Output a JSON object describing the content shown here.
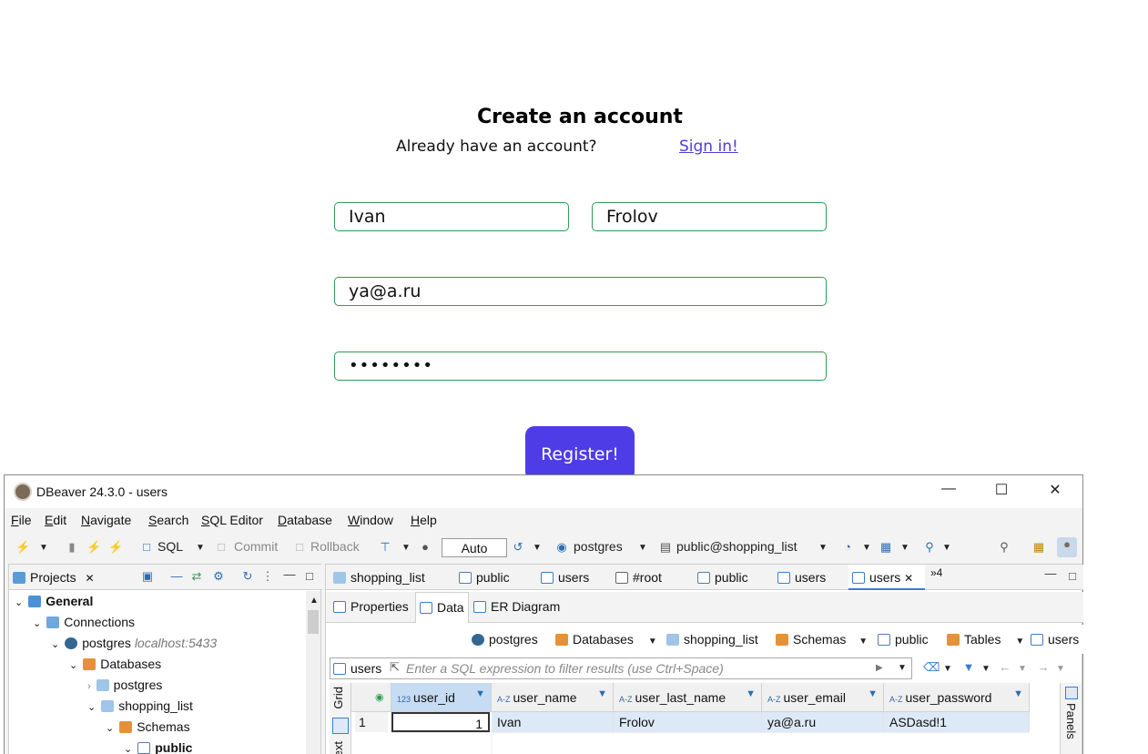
{
  "form": {
    "title": "Create an account",
    "already_text": "Already have an account?",
    "signin_link": "Sign in!",
    "first_name_value": "Ivan",
    "last_name_value": "Frolov",
    "email_value": "ya@a.ru",
    "password_value": "••••••••",
    "register_label": "Register!",
    "accent": "#4e3ce6",
    "border_color": "#2e9b53"
  },
  "dbeaver": {
    "window_title": "DBeaver 24.3.0 - users",
    "menu": [
      {
        "ul": "F",
        "rest": "ile"
      },
      {
        "ul": "E",
        "rest": "dit"
      },
      {
        "ul": "N",
        "rest": "avigate"
      },
      {
        "ul": "S",
        "rest": "earch"
      },
      {
        "ul": "S",
        "rest": "QL Editor"
      },
      {
        "ul": "D",
        "rest": "atabase"
      },
      {
        "ul": "W",
        "rest": "indow"
      },
      {
        "ul": "H",
        "rest": "elp"
      }
    ],
    "toolbar": {
      "sql": "SQL",
      "commit": "Commit",
      "rollback": "Rollback",
      "auto": "Auto",
      "connection": "postgres",
      "schema": "public@shopping_list"
    },
    "projects": {
      "tab": "Projects",
      "tree": [
        {
          "label": "General",
          "bold": true
        },
        {
          "label": "Connections"
        },
        {
          "label": "postgres",
          "extra": "localhost:5433"
        },
        {
          "label": "Databases"
        },
        {
          "label": "postgres"
        },
        {
          "label": "shopping_list"
        },
        {
          "label": "Schemas"
        },
        {
          "label": "public",
          "bold": true
        }
      ]
    },
    "editor_tabs": [
      "shopping_list",
      "public",
      "users",
      "#root",
      "public",
      "users",
      "users"
    ],
    "tabs_overflow": "»4",
    "sub_tabs": [
      "Properties",
      "Data",
      "ER Diagram"
    ],
    "breadcrumbs": [
      "postgres",
      "Databases",
      "shopping_list",
      "Schemas",
      "public",
      "Tables",
      "users"
    ],
    "filter": {
      "table_label": "users",
      "placeholder": "Enter a SQL expression to filter results (use Ctrl+Space)"
    },
    "grid": {
      "vtab": "Grid",
      "vtab2": "Text",
      "columns": [
        "user_id",
        "user_name",
        "user_last_name",
        "user_email",
        "user_password"
      ],
      "rows": [
        {
          "n": "1",
          "cells": [
            "1",
            "Ivan",
            "Frolov",
            "ya@a.ru",
            "ASDasd!1"
          ]
        }
      ],
      "panels_label": "Panels"
    }
  }
}
